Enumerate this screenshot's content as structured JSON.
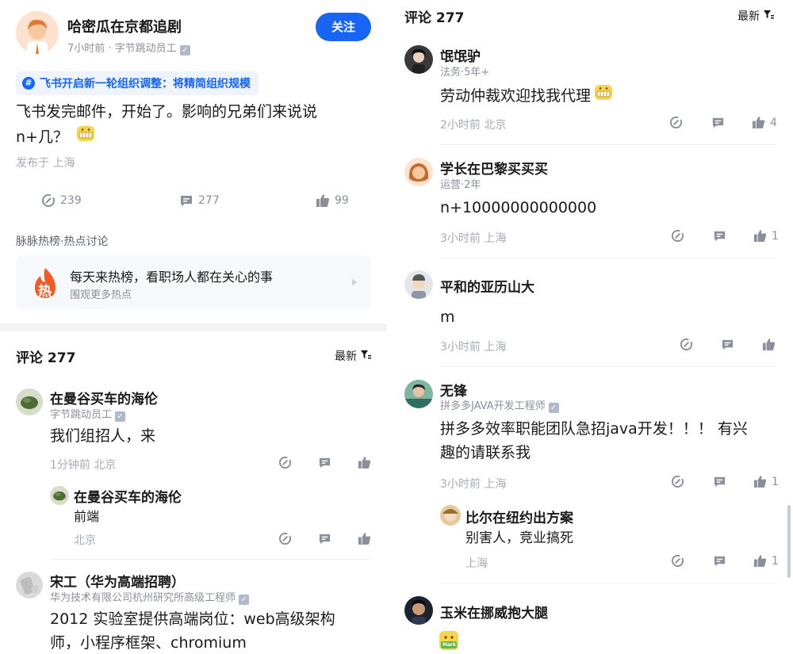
{
  "post": {
    "author": "哈密瓜在京都追剧",
    "meta": "7小时前 · 字节跳动员工",
    "follow_label": "关注",
    "topic": "飞书开启新一轮组织调整：将精简组织规模",
    "text_line1": "飞书发完邮件，开始了。影响的兄弟们来说说",
    "text_line2": "n+几？",
    "location": "发布于 上海",
    "repost_count": "239",
    "comment_count": "277",
    "like_count": "99"
  },
  "hot": {
    "section_title": "脉脉热榜·热点讨论",
    "badge": "热",
    "title": "每天来热榜，看职场人都在关心的事",
    "subtitle": "围观更多热点"
  },
  "comments_header": {
    "title": "评论 277",
    "sort_label": "最新"
  },
  "left_comments": [
    {
      "name": "在曼谷买车的海伦",
      "role": "字节跳动员工",
      "text": "我们组招人，来",
      "time": "1分钟前  北京",
      "reply": {
        "name": "在曼谷买车的海伦",
        "text": "前端",
        "time": "北京"
      }
    },
    {
      "name": "宋工（华为高端招聘）",
      "role": "华为技术有限公司杭州研究所高级工程师",
      "text_line1": "2012 实验室提供高端岗位：web高级架构",
      "text_line2": "师，小程序框架、chromium"
    }
  ],
  "right_comments": [
    {
      "name": "氓氓驴",
      "role": "法务·5年+",
      "text": "劳动仲裁欢迎找我代理",
      "time": "2小时前  北京",
      "likes": "4"
    },
    {
      "name": "学长在巴黎买买买",
      "role": "运营·2年",
      "text": "n+10000000000000",
      "time": "3小时前  上海",
      "likes": "1"
    },
    {
      "name": "平和的亚历山大",
      "role": "",
      "text": "m",
      "time": "3小时前  上海",
      "likes": ""
    },
    {
      "name": "无锋",
      "role": "拼多多JAVA开发工程师",
      "text_line1": "拼多多效率职能团队急招java开发！！！ 有兴",
      "text_line2": "趣的请联系我",
      "time": "3小时前  上海",
      "likes": "1",
      "reply": {
        "name": "比尔在纽约出方案",
        "text": "别害人，竞业搞死",
        "time": "上海",
        "likes": "1"
      }
    },
    {
      "name": "玉米在挪威抱大腿",
      "role": "",
      "sticker": "Mark"
    }
  ],
  "colors": {
    "accent": "#1764f5",
    "topic_bg": "#eef3fe",
    "hot_bg": "#f6f8fb",
    "hot_badge": "#f25b24"
  },
  "icons": [
    "repost-icon",
    "comment-icon",
    "like-icon",
    "filter-icon",
    "verified-icon",
    "hashtag-icon",
    "chevron-right-icon",
    "emoji-grin-icon"
  ]
}
